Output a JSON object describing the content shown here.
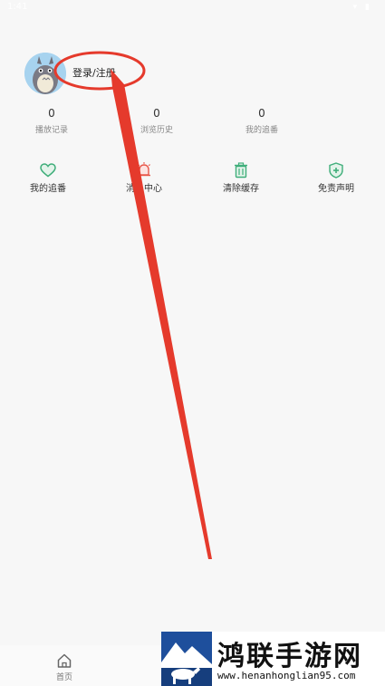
{
  "status_bar": {
    "time": "1:41",
    "icons": "▾ ▮"
  },
  "profile": {
    "login_text": "登录/注册"
  },
  "stats": [
    {
      "value": "0",
      "label": "播放记录"
    },
    {
      "value": "0",
      "label": "浏览历史"
    },
    {
      "value": "0",
      "label": "我的追番"
    }
  ],
  "shortcuts": [
    {
      "label": "我的追番",
      "icon": "heart-icon"
    },
    {
      "label": "消息中心",
      "icon": "bell-icon"
    },
    {
      "label": "清除缓存",
      "icon": "trash-icon"
    },
    {
      "label": "免责声明",
      "icon": "shield-icon"
    }
  ],
  "tabbar": {
    "home_label": "首页"
  },
  "watermark": {
    "title": "鸿联手游网",
    "url": "www.henanhonglian95.com"
  },
  "colors": {
    "annotation": "#e53a2c",
    "accent": "#3fae7a",
    "alert": "#e8574a",
    "logo_blue": "#1e4f9c"
  }
}
